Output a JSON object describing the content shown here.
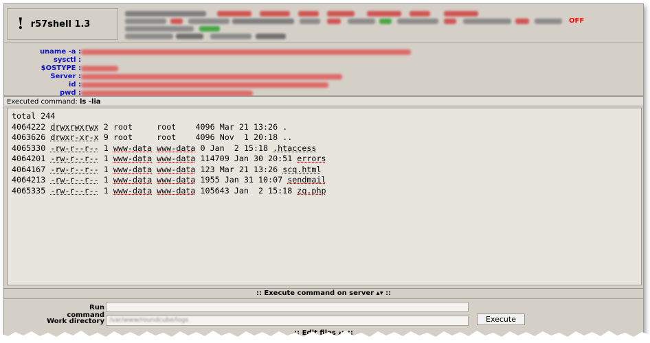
{
  "app": {
    "name": "r57shell 1.3",
    "mark": "!"
  },
  "header": {
    "status_blurred": [
      {
        "color": "#606060"
      },
      {
        "color": "#d03030"
      },
      {
        "color": "#d03030"
      },
      {
        "color": "#d03030"
      },
      {
        "color": "#d03030"
      },
      {
        "color": "#d03030"
      },
      {
        "color": "#d03030"
      },
      {
        "color": "#d03030"
      }
    ],
    "off_label": "OFF"
  },
  "info": {
    "rows": [
      {
        "label": "uname -a :"
      },
      {
        "label": "sysctl :"
      },
      {
        "label": "$OSTYPE :"
      },
      {
        "label": "Server :"
      },
      {
        "label": "id :"
      },
      {
        "label": "pwd :"
      }
    ],
    "value_color": "#e03030"
  },
  "executed": {
    "label": "Executed command:",
    "command": "ls -lia"
  },
  "output": {
    "total": "total 244",
    "rows": [
      {
        "inode": "4064222",
        "perms": "drwxrwxrwx",
        "links": "2",
        "owner": "root",
        "group": "root",
        "size": "4096",
        "date": "Mar 21 13:26",
        "name": "."
      },
      {
        "inode": "4063626",
        "perms": "drwxr-xr-x",
        "links": "9",
        "owner": "root",
        "group": "root",
        "size": "4096",
        "date": "Nov  1 20:18",
        "name": ".."
      },
      {
        "inode": "4065330",
        "perms": "-rw-r--r--",
        "links": "1",
        "owner": "www-data",
        "group": "www-data",
        "size": "0",
        "date": "Jan  2 15:18",
        "name": ".htaccess"
      },
      {
        "inode": "4064201",
        "perms": "-rw-r--r--",
        "links": "1",
        "owner": "www-data",
        "group": "www-data",
        "size": "114709",
        "date": "Jan 30 20:51",
        "name": "errors"
      },
      {
        "inode": "4064167",
        "perms": "-rw-r--r--",
        "links": "1",
        "owner": "www-data",
        "group": "www-data",
        "size": "123",
        "date": "Mar 21 13:26",
        "name": "scq.html"
      },
      {
        "inode": "4064213",
        "perms": "-rw-r--r--",
        "links": "1",
        "owner": "www-data",
        "group": "www-data",
        "size": "1955",
        "date": "Jan 31 10:07",
        "name": "sendmail"
      },
      {
        "inode": "4065335",
        "perms": "-rw-r--r--",
        "links": "1",
        "owner": "www-data",
        "group": "www-data",
        "size": "105643",
        "date": "Jan  2 15:18",
        "name": "zq.php"
      }
    ]
  },
  "execute_section": {
    "title": ":: Execute command on server ▴▾ ::",
    "run_label": "Run command",
    "run_value": "",
    "workdir_label": "Work directory",
    "workdir_value": "/var/www/roundcube/logs",
    "button": "Execute"
  },
  "next_section": {
    "title": ":: Edit files ▴▾ ::"
  }
}
